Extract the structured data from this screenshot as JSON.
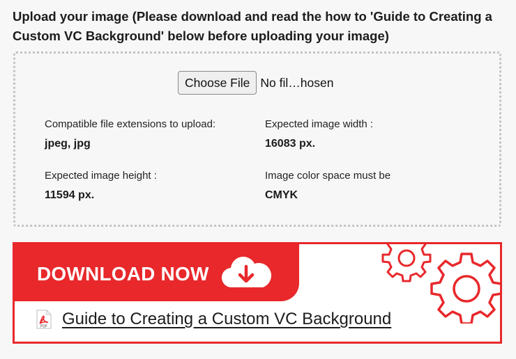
{
  "upload": {
    "heading": "Upload your image (Please download and read the how to 'Guide to Creating a Custom VC Background' below before uploading your image)",
    "choose_file_label": "Choose File",
    "file_status": "No fil…hosen",
    "info": [
      {
        "label": "Compatible file extensions to upload:",
        "value": "jpeg, jpg"
      },
      {
        "label": "Expected image width :",
        "value": "16083 px."
      },
      {
        "label": "Expected image height :",
        "value": "11594 px."
      },
      {
        "label": "Image color space must be",
        "value": "CMYK"
      }
    ]
  },
  "banner": {
    "download_label": "DOWNLOAD NOW",
    "guide_link_text": "Guide to Creating a Custom VC Background",
    "pdf_icon_text": "PDF",
    "icons": [
      "cloud-download-icon",
      "gears-icon",
      "pdf-icon"
    ],
    "accent_color": "#e8282b"
  }
}
